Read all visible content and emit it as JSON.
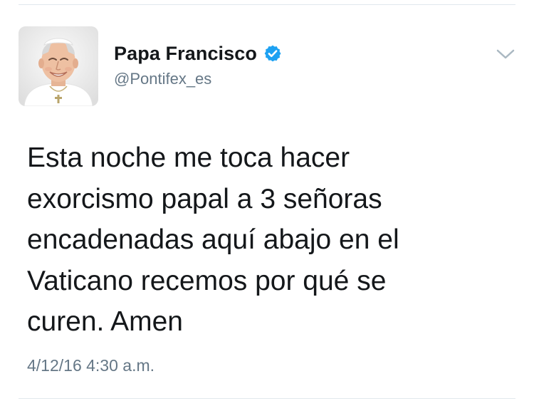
{
  "tweet": {
    "display_name": "Papa Francisco",
    "handle": "@Pontifex_es",
    "text": "Esta noche me toca hacer\nexorcismo papal a 3 señoras\nencadenadas aquí abajo en el\nVaticano recemos por qué se\ncuren. Amen",
    "timestamp": "4/12/16 4:30 a.m.",
    "verified": true
  },
  "icons": {
    "verified": "verified-badge-icon",
    "menu": "chevron-down-icon"
  },
  "colors": {
    "verified_blue": "#1da1f2",
    "text_primary": "#14171a",
    "text_secondary": "#657786",
    "divider": "#e1e8ed"
  }
}
